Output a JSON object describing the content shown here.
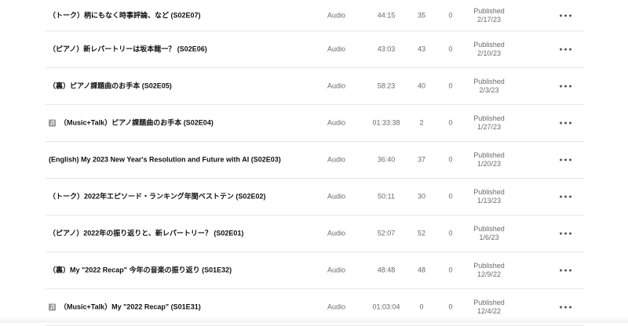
{
  "episodes": [
    {
      "title": "（トーク）柄にもなく時事評論、など (S02E07)",
      "type": "Audio",
      "duration": "44:15",
      "plays": "35",
      "comments": "0",
      "status": "Published",
      "date": "2/17/23",
      "music": false
    },
    {
      "title": "（ピアノ）新レパートリーは坂本龍一？ (S02E06)",
      "type": "Audio",
      "duration": "43:03",
      "plays": "43",
      "comments": "0",
      "status": "Published",
      "date": "2/10/23",
      "music": false
    },
    {
      "title": "（裏）ピアノ課題曲のお手本 (S02E05)",
      "type": "Audio",
      "duration": "58:23",
      "plays": "40",
      "comments": "0",
      "status": "Published",
      "date": "2/3/23",
      "music": false
    },
    {
      "title": "（Music+Talk）ピアノ課題曲のお手本 (S02E04)",
      "type": "Audio",
      "duration": "01:33:38",
      "plays": "2",
      "comments": "0",
      "status": "Published",
      "date": "1/27/23",
      "music": true
    },
    {
      "title": "(English) My 2023 New Year's Resolution and Future with AI (S02E03)",
      "type": "Audio",
      "duration": "36:40",
      "plays": "37",
      "comments": "0",
      "status": "Published",
      "date": "1/20/23",
      "music": false
    },
    {
      "title": "（トーク）2022年エピソード・ランキング年間ベストテン (S02E02)",
      "type": "Audio",
      "duration": "50:11",
      "plays": "30",
      "comments": "0",
      "status": "Published",
      "date": "1/13/23",
      "music": false
    },
    {
      "title": "（ピアノ）2022年の振り返りと、新レパートリー？ (S02E01)",
      "type": "Audio",
      "duration": "52:07",
      "plays": "52",
      "comments": "0",
      "status": "Published",
      "date": "1/6/23",
      "music": false
    },
    {
      "title": "（裏）My \"2022 Recap\" 今年の音楽の振り返り (S01E32)",
      "type": "Audio",
      "duration": "48:48",
      "plays": "48",
      "comments": "0",
      "status": "Published",
      "date": "12/9/22",
      "music": false
    },
    {
      "title": "（Music+Talk）My \"2022 Recap\" (S01E31)",
      "type": "Audio",
      "duration": "01:03:04",
      "plays": "0",
      "comments": "0",
      "status": "Published",
      "date": "12/4/22",
      "music": true
    }
  ],
  "icons": {
    "music": "music-note-icon",
    "more": "more-options-icon"
  },
  "colors": {
    "text": "#111111",
    "muted": "#6a6a6a",
    "divider": "#e6e6e6"
  }
}
